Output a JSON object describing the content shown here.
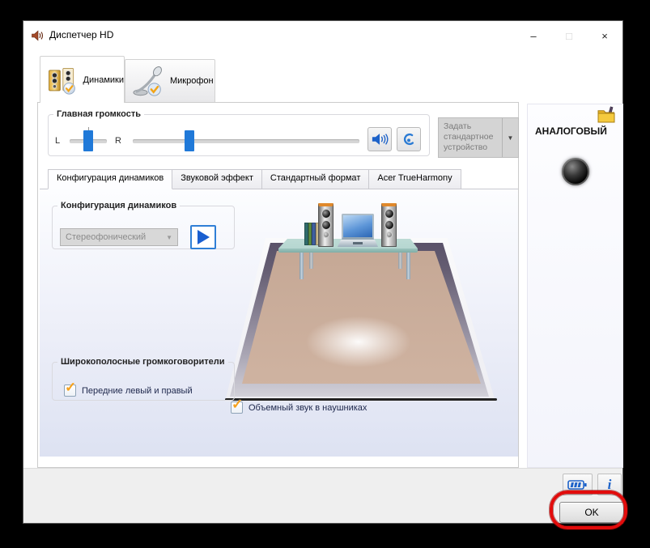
{
  "window": {
    "title": "Диспетчер HD",
    "minimize": "–",
    "maximize": "□",
    "close": "×"
  },
  "device_tabs": [
    {
      "label": "Динамики",
      "active": true
    },
    {
      "label": "Микрофон",
      "active": false
    }
  ],
  "master_volume": {
    "group_label": "Главная громкость",
    "left_label": "L",
    "right_label": "R",
    "balance_percent": 50,
    "volume_percent": 25
  },
  "default_device_button": {
    "label": "Задать стандартное устройство"
  },
  "config_tabs": [
    {
      "label": "Конфигурация динамиков",
      "active": true
    },
    {
      "label": "Звуковой эффект",
      "active": false
    },
    {
      "label": "Стандартный формат",
      "active": false
    },
    {
      "label": "Acer TrueHarmony",
      "active": false
    }
  ],
  "speaker_config": {
    "group_label": "Конфигурация динамиков",
    "selected_option": "Стереофонический"
  },
  "fullrange_group": {
    "group_label": "Широкополосные громкоговорители",
    "checkbox_label": "Передние левый и правый",
    "checked": true
  },
  "surround_checkbox": {
    "label": "Объемный звук в наушниках",
    "checked": true
  },
  "right_panel": {
    "title": "АНАЛОГОВЫЙ"
  },
  "footer": {
    "ok_label": "OK"
  },
  "glyphs": {
    "check": "✓",
    "dropdown_arrow": "▼",
    "select_chevron": "▼"
  },
  "colors": {
    "slider_blue": "#2079d8",
    "accent_blue": "#1d62c9",
    "check_orange": "#f5a11d",
    "annotation_red": "#e20b0b",
    "content_top": "#fcfdff",
    "content_bottom": "#dde2f2"
  }
}
